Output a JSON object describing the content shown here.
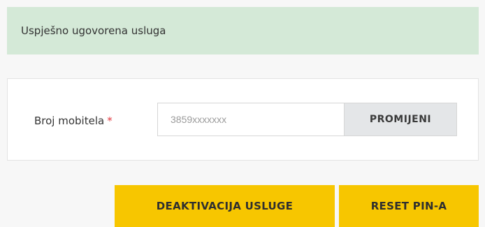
{
  "alert": {
    "message": "Uspješno ugovorena usluga",
    "color": "#d4e9d7"
  },
  "form": {
    "phone_label": "Broj mobitela",
    "required_marker": "*",
    "phone_placeholder": "3859xxxxxxx",
    "phone_value": "",
    "change_button": "PROMIJENI"
  },
  "actions": {
    "deactivate_label": "DEAKTIVACIJA USLUGE",
    "reset_pin_label": "RESET PIN-A",
    "accent_color": "#f7c600"
  }
}
